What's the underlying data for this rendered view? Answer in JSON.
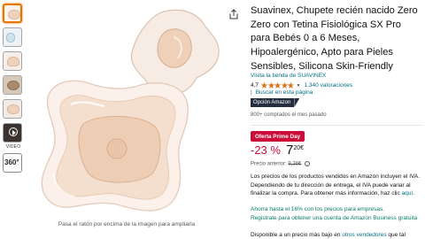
{
  "gallery": {
    "video_label": "VIDEO",
    "spin_label": "360°",
    "hover_hint": "Pasa el ratón por encima de la imagen para ampliarla"
  },
  "product": {
    "title": "Suavinex, Chupete recién nacido Zero Zero con Tetina Fisiológica SX Pro para Bebés 0 a 6 Meses, Hipoalergénico, Apto para Pieles Sensibles, Silicona Skin-Friendly",
    "store_link": "Visita la tienda de SUAVINEX",
    "rating_value": "4,7",
    "rating": 4.7,
    "rating_count_text": "1.340 valoraciones",
    "search_link": "Buscar en esta página",
    "badge": "Opción Amazon",
    "bought_text": "800+ comprados el mes pasado"
  },
  "pricing": {
    "deal_label": "Oferta Prime Day",
    "discount": "-23 %",
    "price_whole": "7",
    "price_fraction": "20€",
    "list_price_label": "Precio anterior:",
    "list_price": "9,36€",
    "tax_text": "Los precios de los productos vendidos en Amazon incluyen el IVA. Dependiendo de tu dirección de entrega, el IVA puede variar al finalizar la compra. Para obtener más información, haz clic ",
    "tax_link": "aquí",
    "promo_line1": "Ahorra hasta el 16% con los precios para empresas.",
    "promo_line2": "Registrate para obtener una cuenta de Amazon Business gratuita",
    "availability_prefix": "Disponible a un precio más bajo en ",
    "availability_link": "otros vendedores",
    "availability_suffix": " que tal"
  },
  "colors": {
    "accent": "#e77600",
    "link": "#007185",
    "deal_red": "#cc0c39",
    "promo_green": "#067d62",
    "star": "#de7921"
  }
}
